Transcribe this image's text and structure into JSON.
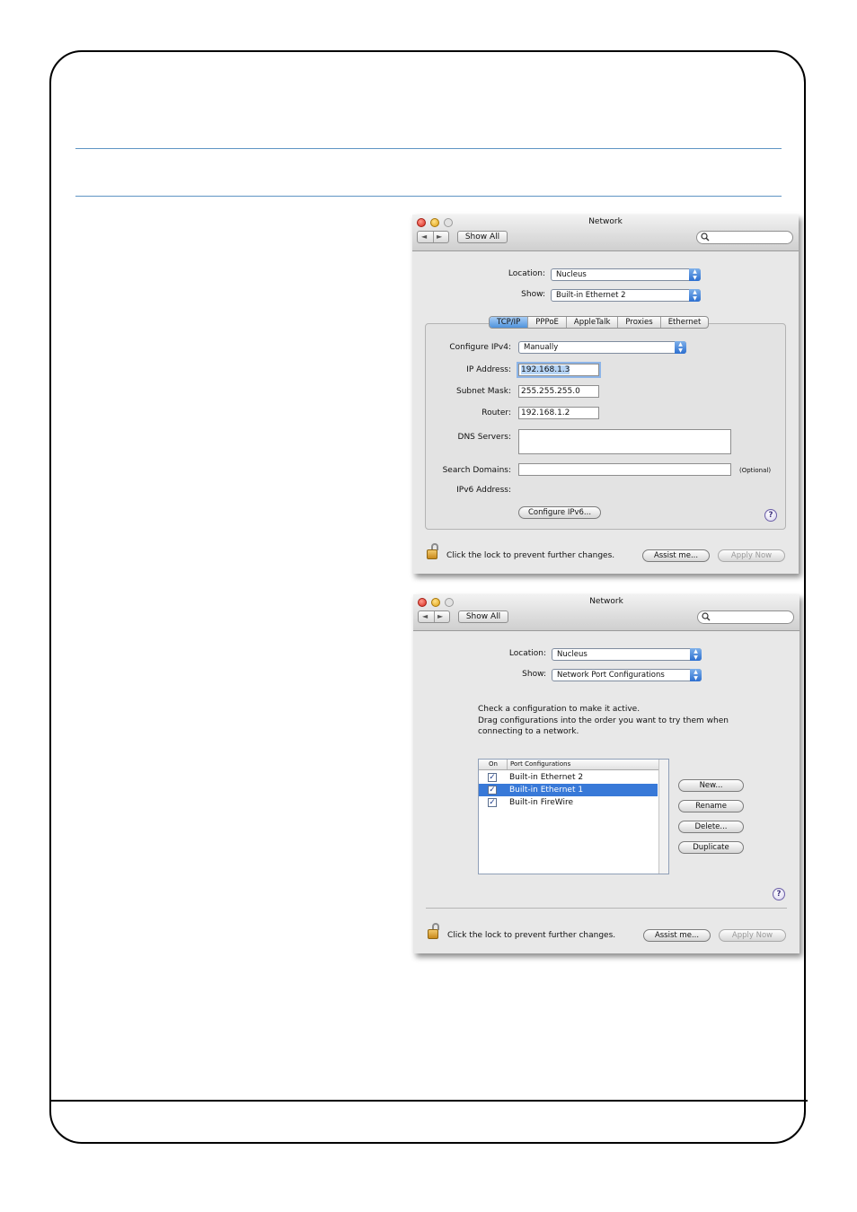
{
  "window1": {
    "title": "Network",
    "nav_back": "◄",
    "nav_forward": "►",
    "show_all": "Show All",
    "search_placeholder": "",
    "location_label": "Location:",
    "location_value": "Nucleus",
    "show_label": "Show:",
    "show_value": "Built-in Ethernet 2",
    "tabs": [
      "TCP/IP",
      "PPPoE",
      "AppleTalk",
      "Proxies",
      "Ethernet"
    ],
    "configure_label": "Configure IPv4:",
    "configure_value": "Manually",
    "ip_label": "IP Address:",
    "ip_value": "192.168.1.3",
    "subnet_label": "Subnet Mask:",
    "subnet_value": "255.255.255.0",
    "router_label": "Router:",
    "router_value": "192.168.1.2",
    "dns_label": "DNS Servers:",
    "dns_value": "",
    "search_domains_label": "Search Domains:",
    "search_domains_value": "",
    "optional_label": "(Optional)",
    "ipv6_label": "IPv6 Address:",
    "configure_ipv6_button": "Configure IPv6...",
    "help": "?",
    "lock_text": "Click the lock to prevent further changes.",
    "assist_button": "Assist me...",
    "apply_button": "Apply Now"
  },
  "window2": {
    "title": "Network",
    "nav_back": "◄",
    "nav_forward": "►",
    "show_all": "Show All",
    "search_placeholder": "",
    "location_label": "Location:",
    "location_value": "Nucleus",
    "show_label": "Show:",
    "show_value": "Network Port Configurations",
    "message": [
      "Check a configuration to make it active.",
      "Drag configurations into the order you want to try them when",
      "connecting to a network."
    ],
    "col_on": "On",
    "col_port": "Port Configurations",
    "rows": [
      {
        "label": "Built-in Ethernet 2",
        "checked": true,
        "selected": false
      },
      {
        "label": "Built-in Ethernet 1",
        "checked": true,
        "selected": true
      },
      {
        "label": "Built-in FireWire",
        "checked": true,
        "selected": false
      }
    ],
    "new_button": "New...",
    "rename_button": "Rename",
    "delete_button": "Delete...",
    "duplicate_button": "Duplicate",
    "help": "?",
    "lock_text": "Click the lock to prevent further changes.",
    "assist_button": "Assist me...",
    "apply_button": "Apply Now"
  },
  "colors": {
    "rule": "#5f95c4",
    "selection": "#3879d8",
    "popup_arrow": "#2c6fd0"
  },
  "icons": [
    "search-icon",
    "lock-icon",
    "help-icon",
    "checkbox-icon"
  ]
}
